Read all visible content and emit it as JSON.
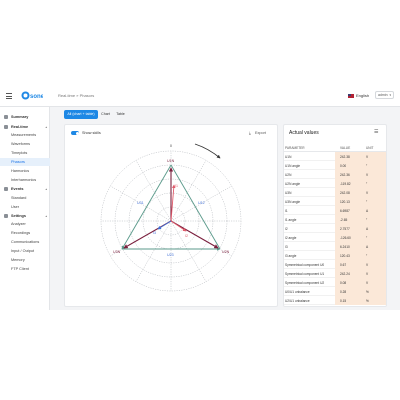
{
  "topbar": {
    "logo_text": "sonel",
    "breadcrumb": "Real-time » Phasors",
    "language": "English",
    "user": "admin"
  },
  "sidebar": {
    "items": [
      {
        "label": "Summary",
        "kind": "group",
        "icon": "summary-icon"
      },
      {
        "label": "Real-time",
        "kind": "group",
        "icon": "realtime-icon"
      },
      {
        "label": "Measurements",
        "kind": "sub"
      },
      {
        "label": "Waveforms",
        "kind": "sub"
      },
      {
        "label": "Timeplots",
        "kind": "sub"
      },
      {
        "label": "Phasors",
        "kind": "sub",
        "active": true
      },
      {
        "label": "Harmonics",
        "kind": "sub"
      },
      {
        "label": "Interharmonics",
        "kind": "sub"
      },
      {
        "label": "Events",
        "kind": "group",
        "icon": "events-icon"
      },
      {
        "label": "Standard",
        "kind": "sub"
      },
      {
        "label": "User",
        "kind": "sub"
      },
      {
        "label": "Settings",
        "kind": "group",
        "icon": "settings-icon"
      },
      {
        "label": "Analyzer",
        "kind": "sub"
      },
      {
        "label": "Recordings",
        "kind": "sub"
      },
      {
        "label": "Communications",
        "kind": "sub"
      },
      {
        "label": "Input / Output",
        "kind": "sub"
      },
      {
        "label": "Memory",
        "kind": "sub"
      },
      {
        "label": "FTP Client",
        "kind": "sub"
      }
    ]
  },
  "tabs": [
    "All (chart + table)",
    "Chart",
    "Table"
  ],
  "chart_panel": {
    "toggle_label": "Show skills",
    "export_label": "Export",
    "axis_labels": [
      "0",
      "90",
      "180",
      "270"
    ]
  },
  "phasors": {
    "labels": [
      "U1N",
      "U2N",
      "U3N",
      "U12",
      "U23",
      "U31",
      "I1",
      "I2",
      "I3"
    ],
    "colors": {
      "accent": "#1e88e5",
      "triangle": "#5b9a8b",
      "vector_dark": "#7a1f3d",
      "vector_red": "#e05a6a",
      "vector_blue": "#3f6fd8",
      "grid": "#9aa0a6"
    }
  },
  "actual_values": {
    "title": "Actual values",
    "headers": {
      "parameter": "PARAMETER",
      "value": "VALUE",
      "unit": "UNIT"
    },
    "rows": [
      {
        "p": "U1N",
        "v": "242.38",
        "u": "V"
      },
      {
        "p": "U1N angle",
        "v": "0.00",
        "u": "°"
      },
      {
        "p": "U2N",
        "v": "242.36",
        "u": "V"
      },
      {
        "p": "U2N angle",
        "v": "-119.82",
        "u": "°"
      },
      {
        "p": "U3N",
        "v": "242.08",
        "u": "V"
      },
      {
        "p": "U3N angle",
        "v": "120.13",
        "u": "°"
      },
      {
        "p": "I1",
        "v": "6.6987",
        "u": "A"
      },
      {
        "p": "I1 angle",
        "v": "-2.65",
        "u": "°"
      },
      {
        "p": "I2",
        "v": "2.7577",
        "u": "A"
      },
      {
        "p": "I2 angle",
        "v": "-126.60",
        "u": "°"
      },
      {
        "p": "I3",
        "v": "6.2410",
        "u": "A"
      },
      {
        "p": "I3 angle",
        "v": "120.43",
        "u": "°"
      },
      {
        "p": "Symmetrical component U0",
        "v": "0.67",
        "u": "V"
      },
      {
        "p": "Symmetrical component U1",
        "v": "242.24",
        "u": "V"
      },
      {
        "p": "Symmetrical component U2",
        "v": "0.08",
        "u": "V"
      },
      {
        "p": "U0/U1 unbalance",
        "v": "0.28",
        "u": "%"
      },
      {
        "p": "U2/U1 unbalance",
        "v": "0.15",
        "u": "%"
      }
    ]
  }
}
